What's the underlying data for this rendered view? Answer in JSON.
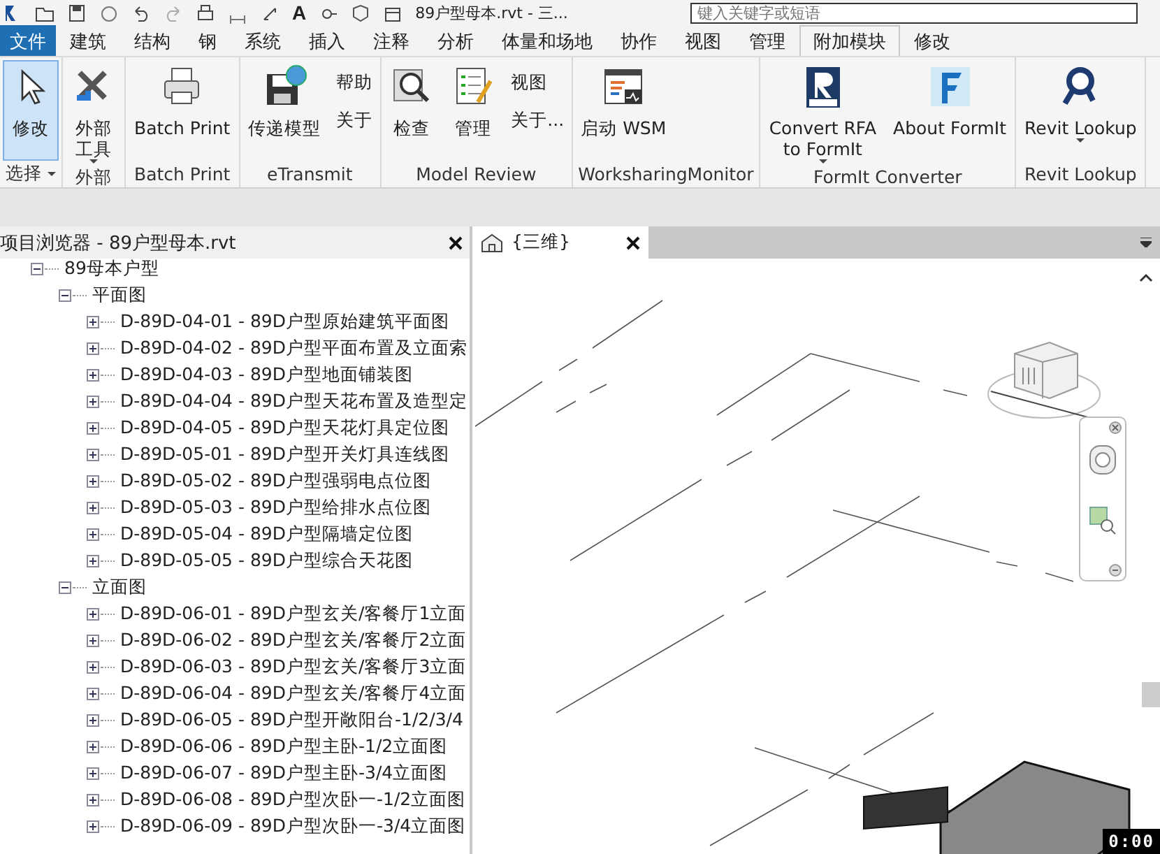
{
  "quick_access": {
    "text_tool": "A",
    "title": "89户型母本.rvt - 三...",
    "search": {
      "placeholder": "键入关键字或短语"
    }
  },
  "tabs": [
    {
      "label": "文件",
      "kind": "file",
      "selected": false
    },
    {
      "label": "建筑",
      "kind": "tab",
      "selected": false
    },
    {
      "label": "结构",
      "kind": "tab",
      "selected": false
    },
    {
      "label": "钢",
      "kind": "tab",
      "selected": false
    },
    {
      "label": "系统",
      "kind": "tab",
      "selected": false
    },
    {
      "label": "插入",
      "kind": "tab",
      "selected": false
    },
    {
      "label": "注释",
      "kind": "tab",
      "selected": false
    },
    {
      "label": "分析",
      "kind": "tab",
      "selected": false
    },
    {
      "label": "体量和场地",
      "kind": "tab",
      "selected": false
    },
    {
      "label": "协作",
      "kind": "tab",
      "selected": false
    },
    {
      "label": "视图",
      "kind": "tab",
      "selected": false
    },
    {
      "label": "管理",
      "kind": "tab",
      "selected": false
    },
    {
      "label": "附加模块",
      "kind": "tab",
      "selected": true
    },
    {
      "label": "修改",
      "kind": "tab",
      "selected": false
    }
  ],
  "ribbon_panels": [
    {
      "title": "选择",
      "dropdown": true,
      "items": [
        {
          "kind": "large",
          "label": "修改",
          "selected": true,
          "dropdown": false
        }
      ]
    },
    {
      "title": "外部",
      "dropdown": false,
      "items": [
        {
          "kind": "large",
          "label": [
            "外部",
            "工具"
          ],
          "selected": false,
          "dropdown": true
        }
      ]
    },
    {
      "title": "Batch Print",
      "dropdown": false,
      "items": [
        {
          "kind": "large",
          "label": "Batch Print",
          "selected": false,
          "dropdown": false
        }
      ]
    },
    {
      "title": "eTransmit",
      "dropdown": false,
      "items": [
        {
          "kind": "large",
          "label": "传递模型",
          "selected": false,
          "dropdown": false
        },
        {
          "kind": "stack",
          "buttons": [
            "帮助",
            "关于"
          ]
        }
      ]
    },
    {
      "title": "Model Review",
      "dropdown": false,
      "items": [
        {
          "kind": "large",
          "label": "检查",
          "selected": false,
          "dropdown": false
        },
        {
          "kind": "large",
          "label": "管理",
          "selected": false,
          "dropdown": false
        },
        {
          "kind": "stack",
          "buttons": [
            "视图",
            "关于..."
          ]
        }
      ]
    },
    {
      "title": "WorksharingMonitor",
      "dropdown": false,
      "items": [
        {
          "kind": "large",
          "label": "启动 WSM",
          "selected": false,
          "dropdown": false
        }
      ]
    },
    {
      "title": "FormIt Converter",
      "dropdown": false,
      "items": [
        {
          "kind": "large",
          "label": [
            "Convert RFA",
            "to FormIt"
          ],
          "selected": false,
          "dropdown": true
        },
        {
          "kind": "large",
          "label": "About FormIt",
          "selected": false,
          "dropdown": false
        }
      ]
    },
    {
      "title": "Revit Lookup",
      "dropdown": false,
      "items": [
        {
          "kind": "large",
          "label": "Revit Lookup",
          "selected": false,
          "dropdown": true
        }
      ]
    }
  ],
  "project_browser": {
    "title": "项目浏览器 - 89户型母本.rvt",
    "tree": [
      {
        "label": "89母本户型",
        "expanded": true,
        "children": [
          {
            "label": "平面图",
            "expanded": true,
            "children": [
              {
                "label": "D-89D-04-01 - 89D户型原始建筑平面图",
                "expanded": false
              },
              {
                "label": "D-89D-04-02 - 89D户型平面布置及立面索",
                "expanded": false
              },
              {
                "label": "D-89D-04-03 - 89D户型地面铺装图",
                "expanded": false
              },
              {
                "label": "D-89D-04-04 - 89D户型天花布置及造型定",
                "expanded": false
              },
              {
                "label": "D-89D-04-05 - 89D户型天花灯具定位图",
                "expanded": false
              },
              {
                "label": "D-89D-05-01 - 89D户型开关灯具连线图",
                "expanded": false
              },
              {
                "label": "D-89D-05-02 - 89D户型强弱电点位图",
                "expanded": false
              },
              {
                "label": "D-89D-05-03 - 89D户型给排水点位图",
                "expanded": false
              },
              {
                "label": "D-89D-05-04 - 89D户型隔墙定位图",
                "expanded": false
              },
              {
                "label": "D-89D-05-05 - 89D户型综合天花图",
                "expanded": false
              }
            ]
          },
          {
            "label": "立面图",
            "expanded": true,
            "children": [
              {
                "label": "D-89D-06-01 - 89D户型玄关/客餐厅1立面",
                "expanded": false
              },
              {
                "label": "D-89D-06-02 - 89D户型玄关/客餐厅2立面",
                "expanded": false
              },
              {
                "label": "D-89D-06-03 - 89D户型玄关/客餐厅3立面",
                "expanded": false
              },
              {
                "label": "D-89D-06-04 - 89D户型玄关/客餐厅4立面",
                "expanded": false
              },
              {
                "label": "D-89D-06-05 - 89D户型开敞阳台-1/2/3/4",
                "expanded": false
              },
              {
                "label": "D-89D-06-06 - 89D户型主卧-1/2立面图",
                "expanded": false
              },
              {
                "label": "D-89D-06-07 - 89D户型主卧-3/4立面图",
                "expanded": false
              },
              {
                "label": "D-89D-06-08 - 89D户型次卧一-1/2立面图",
                "expanded": false
              },
              {
                "label": "D-89D-06-09 - 89D户型次卧一-3/4立面图",
                "expanded": false
              }
            ]
          }
        ]
      }
    ]
  },
  "view": {
    "tab": {
      "label": "{三维}"
    },
    "timer": "0:00"
  }
}
